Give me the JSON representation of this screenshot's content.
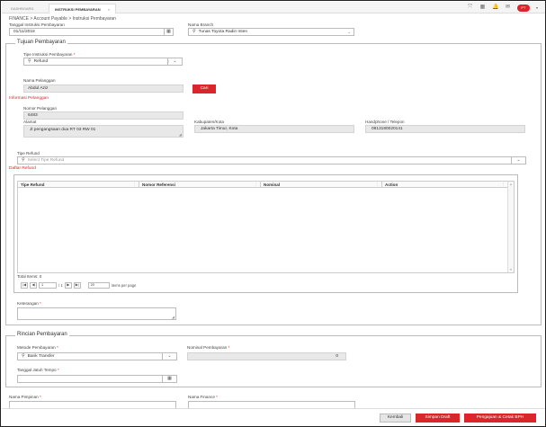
{
  "tabs": [
    {
      "label": "DASHBOARD"
    },
    {
      "label": "INSTRUKSI PEMBAYARAN",
      "close": "×"
    }
  ],
  "topbar_icons": [
    "expand-icon",
    "grid-icon",
    "bell-icon",
    "mail-icon"
  ],
  "glyphs": {
    "expand": "⤧",
    "grid": "▦",
    "bell": "🔔",
    "mail": "✉",
    "caret": "▾",
    "calendar": "▦",
    "search": "⚲",
    "dropdown": "⌄",
    "clear": "×",
    "filter": "⋮",
    "up": "▴",
    "down": "▾",
    "resize": "◢"
  },
  "user": {
    "badge": "PT"
  },
  "breadcrumb": "FINANCE > Account Payable > Instruksi Pembayaran",
  "header": {
    "tanggal_label": "Tanggal Instruksi Pembayaran",
    "tanggal_value": "01/11/2018",
    "branch_label": "Nama Branch",
    "branch_value": "Tunas Toyota Radin Inten"
  },
  "tujuan": {
    "legend": "Tujuan Pembayaran",
    "tipe_label": "Tipe Instruksi Pembayaran",
    "required": "*",
    "tipe_value": "Refund",
    "pelanggan_label": "Nama Pelanggan",
    "pelanggan_value": "Abdul Aziz",
    "cari_label": "Cari",
    "info_title": "Informasi Pelanggan",
    "nomor_label": "Nomor Pelanggan",
    "nomor_value": "6483",
    "alamat_label": "Alamat",
    "alamat_value": "Jl pengangsaan dua RT 03 RW 01",
    "kab_label": "Kabupaten/Kota",
    "kab_value": "Jakarta Timur, Kota",
    "hp_label": "Handphone / Telepon",
    "hp_value": "0813180020141",
    "tipe_refund_label": "Tipe Refund",
    "tipe_refund_placeholder": "Select Tipe Refund",
    "daftar_title": "Daftar Refund",
    "columns": [
      "Tipe Refund",
      "Nomor Referensi",
      "Nominal",
      "Action"
    ],
    "total_items": "Total Items: 0",
    "pager": {
      "first": "|◀",
      "prev": "◀",
      "page": "1",
      "of": "/ 1",
      "next": "▶",
      "last": "▶|",
      "size": "20",
      "per_page": "items per page"
    },
    "keterangan_label": "Keterangan"
  },
  "rincian": {
    "legend": "Rincian Pembayaran",
    "metode_label": "Metode Pembayaran",
    "metode_value": "Bank Transfer",
    "nominal_label": "Nominal Pembayaran",
    "nominal_value": "0",
    "jatuh_tempo_label": "Tanggal Jatuh Tempo"
  },
  "signers": {
    "pimpinan_label": "Nama Pimpinan",
    "finance_label": "Nama Finance"
  },
  "buttons": {
    "kembali": "Kembali",
    "simpan": "Simpan Draft",
    "pengajuan": "Pengajuan & Cetak BPH"
  },
  "colors": {
    "accent": "#d9252b",
    "readonly": "#e8e8e8",
    "border": "#bbbbbb"
  }
}
